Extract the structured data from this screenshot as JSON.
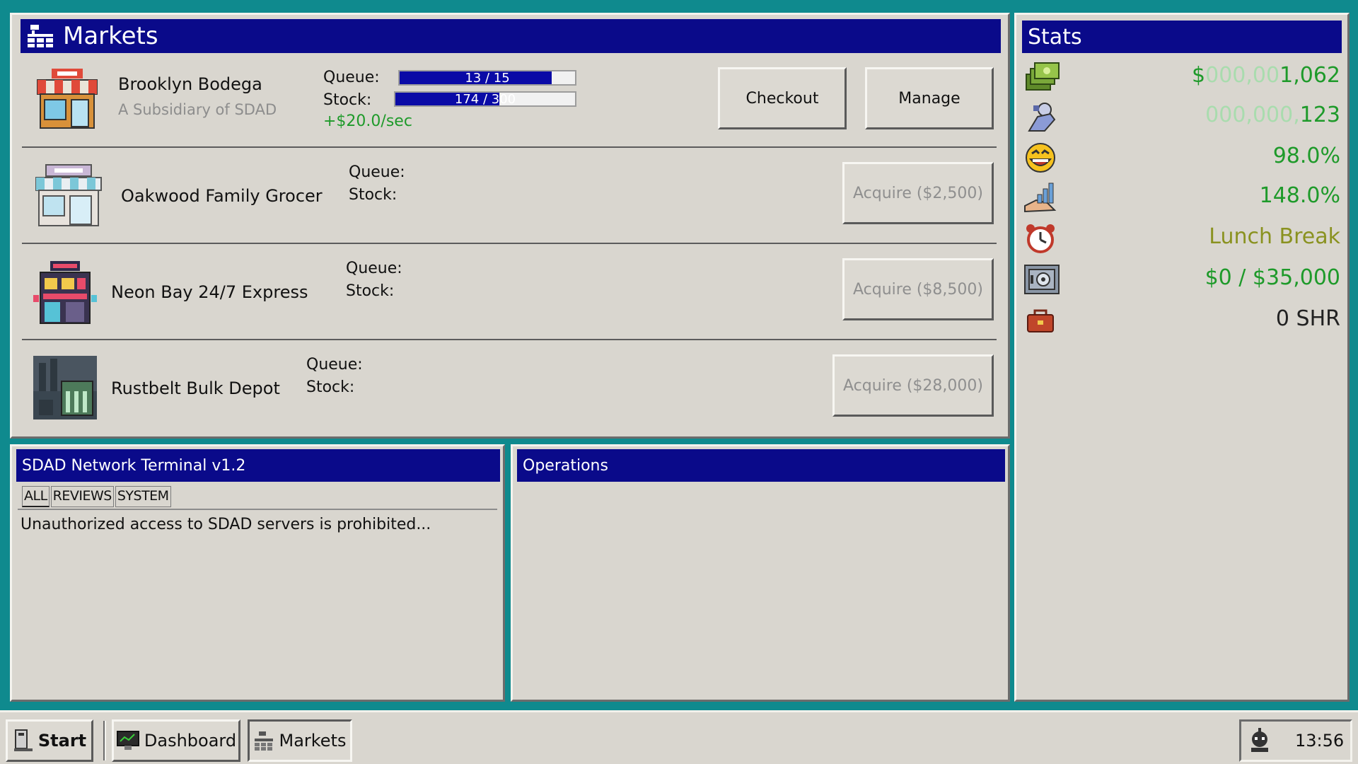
{
  "markets": {
    "title": "Markets",
    "stores": [
      {
        "name": "Brooklyn Bodega",
        "subtitle": "A Subsidiary of SDAD",
        "queue_label": "Queue:",
        "stock_label": "Stock:",
        "queue_text": "13 / 15",
        "queue_fraction": 0.867,
        "stock_text": "174 / 300",
        "stock_fraction": 0.58,
        "rate": "+$20.0/sec",
        "checkout_label": "Checkout",
        "manage_label": "Manage"
      },
      {
        "name": "Oakwood Family Grocer",
        "queue_label": "Queue:",
        "stock_label": "Stock:",
        "acquire_label": "Acquire ($2,500)"
      },
      {
        "name": "Neon Bay 24/7 Express",
        "queue_label": "Queue:",
        "stock_label": "Stock:",
        "acquire_label": "Acquire ($8,500)"
      },
      {
        "name": "Rustbelt Bulk Depot",
        "queue_label": "Queue:",
        "stock_label": "Stock:",
        "acquire_label": "Acquire ($28,000)"
      }
    ]
  },
  "stats": {
    "title": "Stats",
    "money_prefix": "$",
    "money_faded": "000,00",
    "money_value": "1,062",
    "customers_faded": "000,000,",
    "customers_value": "123",
    "happiness": "98.0%",
    "growth": "148.0%",
    "status": "Lunch Break",
    "vault": "$0 / $35,000",
    "shares": "0 SHR",
    "colors": {
      "green": "#1e9a2a",
      "faded_green": "#a9dcae",
      "olive": "#8a9220"
    }
  },
  "terminal": {
    "title": "SDAD Network Terminal v1.2",
    "tabs": [
      "ALL",
      "REVIEWS",
      "SYSTEM"
    ],
    "active_tab": "ALL",
    "lines": [
      "Unauthorized access to SDAD servers is prohibited..."
    ]
  },
  "operations": {
    "title": "Operations"
  },
  "taskbar": {
    "start_label": "Start",
    "items": [
      "Dashboard",
      "Markets"
    ],
    "clock": "13:56"
  }
}
